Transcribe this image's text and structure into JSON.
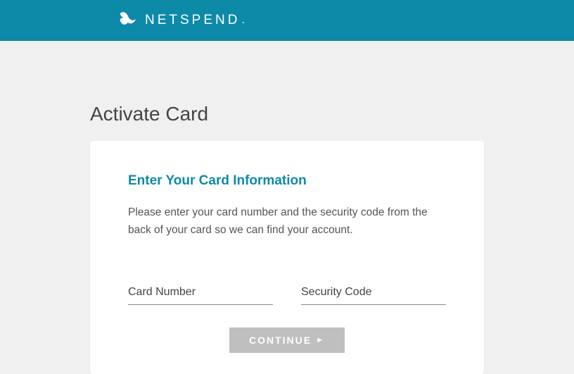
{
  "header": {
    "brand": "NETSPEND"
  },
  "page": {
    "title": "Activate Card",
    "section_title": "Enter Your Card Information",
    "instruction": "Please enter your card number and the security code from the back of your card so we can find your account."
  },
  "form": {
    "card_number": {
      "placeholder": "Card Number",
      "value": ""
    },
    "security_code": {
      "placeholder": "Security Code",
      "value": ""
    },
    "continue_label": "CONTINUE"
  }
}
